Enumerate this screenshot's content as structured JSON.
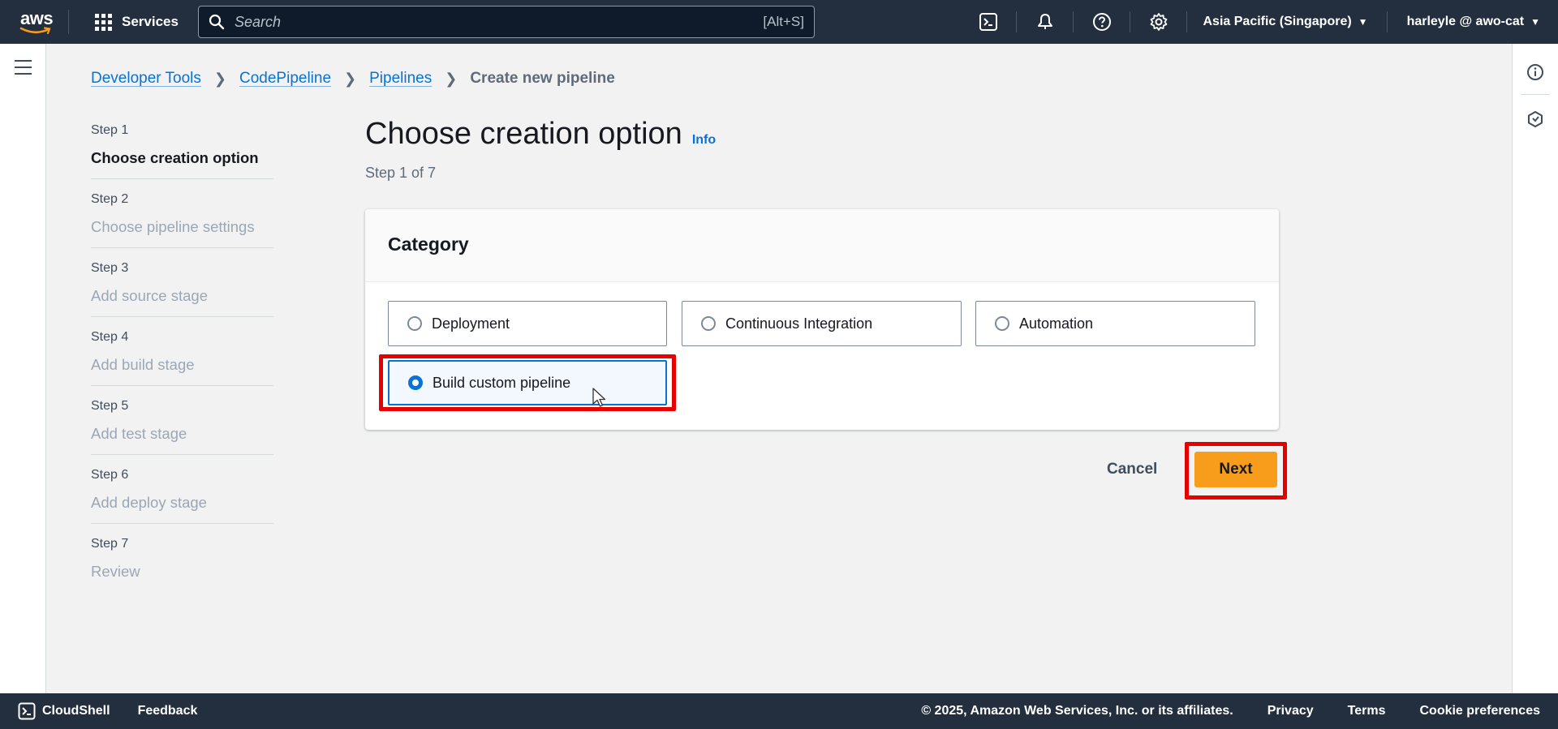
{
  "topnav": {
    "logo_text": "aws",
    "services_label": "Services",
    "search_placeholder": "Search",
    "search_shortcut": "[Alt+S]",
    "icons": [
      "cloudshell-icon",
      "notifications-bell-icon",
      "help-icon",
      "settings-gear-icon"
    ],
    "region": "Asia Pacific (Singapore)",
    "account": "harleyle @ awo-cat"
  },
  "breadcrumb": {
    "items": [
      "Developer Tools",
      "CodePipeline",
      "Pipelines"
    ],
    "current": "Create new pipeline"
  },
  "steps": [
    {
      "num": "Step 1",
      "title": "Choose creation option",
      "active": true
    },
    {
      "num": "Step 2",
      "title": "Choose pipeline settings",
      "active": false
    },
    {
      "num": "Step 3",
      "title": "Add source stage",
      "active": false
    },
    {
      "num": "Step 4",
      "title": "Add build stage",
      "active": false
    },
    {
      "num": "Step 5",
      "title": "Add test stage",
      "active": false
    },
    {
      "num": "Step 6",
      "title": "Add deploy stage",
      "active": false
    },
    {
      "num": "Step 7",
      "title": "Review",
      "active": false
    }
  ],
  "main": {
    "title": "Choose creation option",
    "info_label": "Info",
    "subtitle": "Step 1 of 7",
    "card_title": "Category",
    "options": [
      {
        "label": "Deployment",
        "selected": false
      },
      {
        "label": "Continuous Integration",
        "selected": false
      },
      {
        "label": "Automation",
        "selected": false
      },
      {
        "label": "Build custom pipeline",
        "selected": true
      }
    ],
    "cancel_label": "Cancel",
    "next_label": "Next"
  },
  "footer": {
    "cloudshell_label": "CloudShell",
    "feedback_label": "Feedback",
    "copyright": "© 2025, Amazon Web Services, Inc. or its affiliates.",
    "privacy": "Privacy",
    "terms": "Terms",
    "cookie": "Cookie preferences"
  },
  "colors": {
    "nav_bg": "#232f3e",
    "link": "#0972d3",
    "primary_button": "#f89c1c",
    "highlight": "#e60000"
  }
}
